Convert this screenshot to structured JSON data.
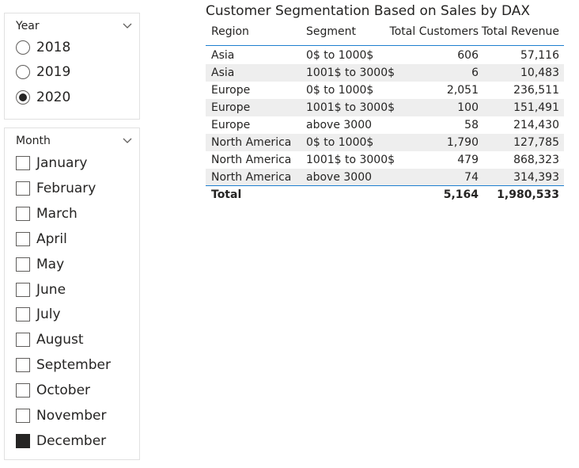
{
  "year_slicer": {
    "title": "Year",
    "options": [
      {
        "label": "2018",
        "selected": false
      },
      {
        "label": "2019",
        "selected": false
      },
      {
        "label": "2020",
        "selected": true
      }
    ]
  },
  "month_slicer": {
    "title": "Month",
    "options": [
      {
        "label": "January",
        "checked": false
      },
      {
        "label": "February",
        "checked": false
      },
      {
        "label": "March",
        "checked": false
      },
      {
        "label": "April",
        "checked": false
      },
      {
        "label": "May",
        "checked": false
      },
      {
        "label": "June",
        "checked": false
      },
      {
        "label": "July",
        "checked": false
      },
      {
        "label": "August",
        "checked": false
      },
      {
        "label": "September",
        "checked": false
      },
      {
        "label": "October",
        "checked": false
      },
      {
        "label": "November",
        "checked": false
      },
      {
        "label": "December",
        "checked": true
      }
    ]
  },
  "table": {
    "title": "Customer Segmentation Based on Sales by DAX",
    "headers": {
      "region": "Region",
      "segment": "Segment",
      "customers": "Total Customers",
      "revenue": "Total Revenue"
    },
    "rows": [
      {
        "region": "Asia",
        "segment": "0$ to 1000$",
        "customers": "606",
        "revenue": "57,116"
      },
      {
        "region": "Asia",
        "segment": "1001$ to 3000$",
        "customers": "6",
        "revenue": "10,483"
      },
      {
        "region": "Europe",
        "segment": "0$ to 1000$",
        "customers": "2,051",
        "revenue": "236,511"
      },
      {
        "region": "Europe",
        "segment": "1001$ to 3000$",
        "customers": "100",
        "revenue": "151,491"
      },
      {
        "region": "Europe",
        "segment": "above 3000",
        "customers": "58",
        "revenue": "214,430"
      },
      {
        "region": "North America",
        "segment": "0$ to 1000$",
        "customers": "1,790",
        "revenue": "127,785"
      },
      {
        "region": "North America",
        "segment": "1001$ to 3000$",
        "customers": "479",
        "revenue": "868,323"
      },
      {
        "region": "North America",
        "segment": "above 3000",
        "customers": "74",
        "revenue": "314,393"
      }
    ],
    "total": {
      "label": "Total",
      "customers": "5,164",
      "revenue": "1,980,533"
    }
  },
  "colors": {
    "accent_line": "#1e7fcf",
    "row_shade": "#eeeeee",
    "text": "#252423"
  }
}
